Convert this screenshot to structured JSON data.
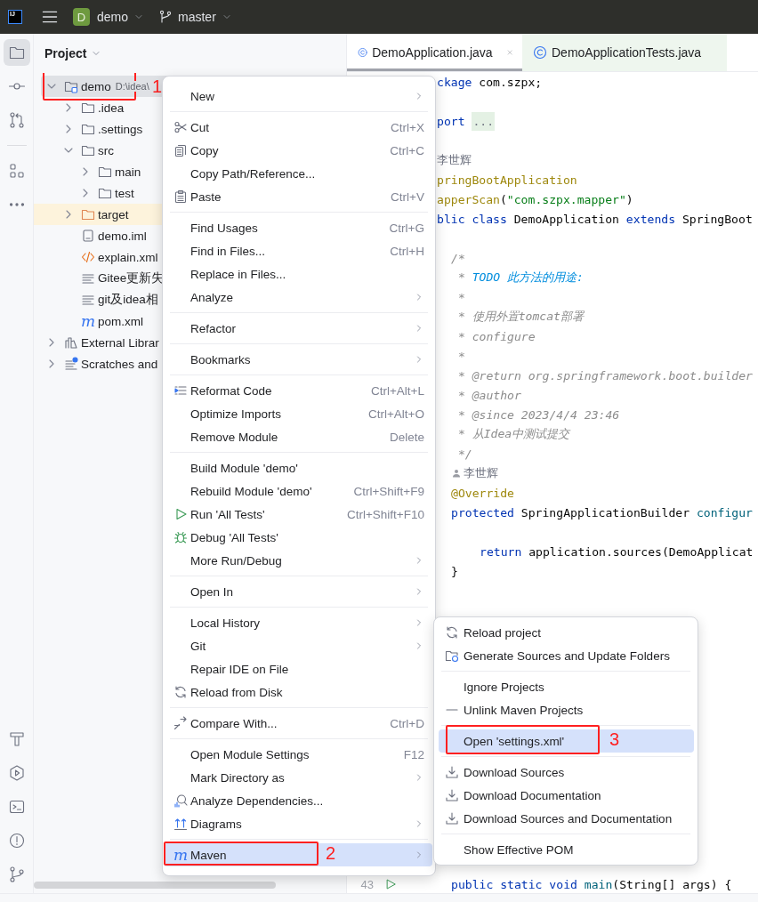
{
  "top_bar": {
    "logo": "IJ",
    "project_badge": "D",
    "project": "demo",
    "branch": "master"
  },
  "tool_strip": {
    "top_groups": [
      [
        {
          "kind": "project",
          "selected": true
        },
        {
          "kind": "commit",
          "selected": false
        },
        {
          "kind": "pull-requests",
          "selected": false
        }
      ],
      [
        {
          "kind": "structure",
          "selected": false
        },
        {
          "kind": "more",
          "selected": false
        }
      ]
    ],
    "bottom": [
      {
        "kind": "build",
        "selected": false
      },
      {
        "kind": "services",
        "selected": false
      },
      {
        "kind": "terminal",
        "selected": false
      },
      {
        "kind": "problems",
        "selected": false
      },
      {
        "kind": "git",
        "selected": false
      }
    ]
  },
  "project": {
    "title": "Project",
    "tree": [
      {
        "label": "demo",
        "path": "D:\\idea\\",
        "kind": "module",
        "expanded": true,
        "selected": true,
        "callout": "1",
        "children": [
          {
            "label": ".idea",
            "kind": "folder",
            "expanded": false,
            "selected": false
          },
          {
            "label": ".settings",
            "kind": "folder",
            "expanded": false,
            "selected": false
          },
          {
            "label": "src",
            "kind": "folder",
            "expanded": true,
            "selected": false,
            "children": [
              {
                "label": "main",
                "kind": "folder",
                "expanded": false,
                "selected": false
              },
              {
                "label": "test",
                "kind": "folder",
                "expanded": false,
                "selected": false
              }
            ]
          },
          {
            "label": "target",
            "kind": "excluded-folder",
            "expanded": false,
            "selected": false
          },
          {
            "label": "demo.iml",
            "kind": "iml",
            "selected": false
          },
          {
            "label": "explain.xml",
            "kind": "xml",
            "selected": false
          },
          {
            "label": "Gitee更新失",
            "kind": "text",
            "selected": false
          },
          {
            "label": "git及idea相",
            "kind": "text",
            "selected": false
          },
          {
            "label": "pom.xml",
            "kind": "maven",
            "glyph": "m",
            "selected": false
          }
        ]
      },
      {
        "label": "External Librar",
        "kind": "libraries",
        "expanded": false,
        "selected": false
      },
      {
        "label": "Scratches and",
        "kind": "scratches",
        "expanded": false,
        "selected": false
      }
    ]
  },
  "editor": {
    "tabs": [
      {
        "label": "DemoApplication.java",
        "kind": "source",
        "selected": true,
        "closable": true
      },
      {
        "label": "DemoApplicationTests.java",
        "kind": "test",
        "selected": false,
        "closable": false
      }
    ],
    "lines": [
      {
        "kind": "top",
        "parts": [
          {
            "kind": "keyword",
            "text": "ckage"
          },
          {
            "kind": "plain",
            "text": " com.szpx;"
          }
        ]
      },
      {
        "kind": "blank"
      },
      {
        "kind": "top",
        "parts": [
          {
            "kind": "keyword",
            "text": "port "
          },
          {
            "kind": "folded",
            "text": "..."
          }
        ]
      },
      {
        "kind": "blank"
      },
      {
        "kind": "top",
        "parts": [
          {
            "kind": "author",
            "text": "李世辉"
          }
        ]
      },
      {
        "kind": "top",
        "parts": [
          {
            "kind": "annotation",
            "text": "pringBootApplication"
          }
        ]
      },
      {
        "kind": "top",
        "parts": [
          {
            "kind": "annotation",
            "text": "apperScan"
          },
          {
            "kind": "plain",
            "text": "("
          },
          {
            "kind": "string",
            "text": "\"com.szpx.mapper\""
          },
          {
            "kind": "plain",
            "text": ")"
          }
        ]
      },
      {
        "kind": "top",
        "parts": [
          {
            "kind": "keyword",
            "text": "blic class"
          },
          {
            "kind": "plain",
            "text": " DemoApplication "
          },
          {
            "kind": "keyword",
            "text": "extends"
          },
          {
            "kind": "plain",
            "text": " SpringBoot"
          }
        ]
      },
      {
        "kind": "blank"
      },
      {
        "kind": "member",
        "parts": [
          {
            "kind": "comment",
            "text": "/*"
          }
        ]
      },
      {
        "kind": "member",
        "parts": [
          {
            "kind": "comment",
            "text": " * "
          },
          {
            "kind": "todo",
            "text": "TODO 此方法的用途:"
          }
        ]
      },
      {
        "kind": "member",
        "parts": [
          {
            "kind": "comment",
            "text": " *"
          }
        ]
      },
      {
        "kind": "member",
        "parts": [
          {
            "kind": "comment",
            "text": " * 使用外置tomcat部署"
          }
        ]
      },
      {
        "kind": "member",
        "parts": [
          {
            "kind": "comment",
            "text": " * configure"
          }
        ]
      },
      {
        "kind": "member",
        "parts": [
          {
            "kind": "comment",
            "text": " *"
          }
        ]
      },
      {
        "kind": "member",
        "parts": [
          {
            "kind": "comment",
            "text": " * "
          },
          {
            "kind": "doc-tag",
            "text": "@return"
          },
          {
            "kind": "comment",
            "text": " org.springframework.boot.builder"
          }
        ]
      },
      {
        "kind": "member",
        "parts": [
          {
            "kind": "comment",
            "text": " * "
          },
          {
            "kind": "doc-tag",
            "text": "@author"
          }
        ]
      },
      {
        "kind": "member",
        "parts": [
          {
            "kind": "comment",
            "text": " * "
          },
          {
            "kind": "doc-tag",
            "text": "@since"
          },
          {
            "kind": "comment",
            "text": " 2023/4/4 23:46"
          }
        ]
      },
      {
        "kind": "member",
        "parts": [
          {
            "kind": "comment",
            "text": " * 从Idea中测试提交"
          }
        ]
      },
      {
        "kind": "member",
        "parts": [
          {
            "kind": "comment",
            "text": " */"
          }
        ]
      },
      {
        "kind": "author",
        "parts": [
          {
            "kind": "author",
            "text": "李世辉"
          }
        ]
      },
      {
        "kind": "member",
        "parts": [
          {
            "kind": "annotation",
            "text": "@Override"
          }
        ]
      },
      {
        "kind": "member",
        "parts": [
          {
            "kind": "keyword",
            "text": "protected"
          },
          {
            "kind": "plain",
            "text": " SpringApplicationBuilder "
          },
          {
            "kind": "method",
            "text": "configur"
          }
        ]
      },
      {
        "kind": "blank"
      },
      {
        "kind": "body",
        "parts": [
          {
            "kind": "keyword",
            "text": "return"
          },
          {
            "kind": "plain",
            "text": " application.sources(DemoApplicat"
          }
        ]
      },
      {
        "kind": "member",
        "parts": [
          {
            "kind": "plain",
            "text": "}"
          }
        ]
      },
      {
        "kind": "blank"
      },
      {
        "kind": "blank"
      },
      {
        "kind": "blank"
      },
      {
        "kind": "blank"
      },
      {
        "kind": "blank"
      },
      {
        "kind": "blank"
      },
      {
        "kind": "blank"
      },
      {
        "kind": "blank"
      },
      {
        "kind": "blank"
      },
      {
        "kind": "blank"
      },
      {
        "kind": "blank"
      },
      {
        "kind": "blank"
      },
      {
        "kind": "blank"
      },
      {
        "kind": "blank"
      },
      {
        "kind": "blank"
      },
      {
        "kind": "member",
        "number": "43",
        "parts": [
          {
            "kind": "keyword",
            "text": "public static void "
          },
          {
            "kind": "method",
            "text": "main"
          },
          {
            "kind": "plain",
            "text": "(String[] args) {"
          }
        ]
      }
    ]
  },
  "context_menu": {
    "groups": [
      {
        "items": [
          {
            "label": "New",
            "kind": "plain",
            "submenu": true,
            "selected": false
          }
        ]
      },
      {
        "items": [
          {
            "label": "Cut",
            "kind": "cut",
            "shortcut": "Ctrl+X",
            "submenu": false,
            "selected": false
          },
          {
            "label": "Copy",
            "kind": "copy",
            "shortcut": "Ctrl+C",
            "submenu": false,
            "selected": false
          },
          {
            "label": "Copy Path/Reference...",
            "kind": "plain",
            "submenu": false,
            "selected": false
          },
          {
            "label": "Paste",
            "kind": "paste",
            "shortcut": "Ctrl+V",
            "submenu": false,
            "selected": false
          }
        ]
      },
      {
        "items": [
          {
            "label": "Find Usages",
            "kind": "plain",
            "shortcut": "Ctrl+G",
            "submenu": false,
            "selected": false
          },
          {
            "label": "Find in Files...",
            "kind": "plain",
            "shortcut": "Ctrl+H",
            "submenu": false,
            "selected": false
          },
          {
            "label": "Replace in Files...",
            "kind": "plain",
            "submenu": false,
            "selected": false
          },
          {
            "label": "Analyze",
            "kind": "plain",
            "submenu": true,
            "selected": false
          }
        ]
      },
      {
        "items": [
          {
            "label": "Refactor",
            "kind": "plain",
            "submenu": true,
            "selected": false
          }
        ]
      },
      {
        "items": [
          {
            "label": "Bookmarks",
            "kind": "plain",
            "submenu": true,
            "selected": false
          }
        ]
      },
      {
        "items": [
          {
            "label": "Reformat Code",
            "kind": "reformat",
            "shortcut": "Ctrl+Alt+L",
            "submenu": false,
            "selected": false
          },
          {
            "label": "Optimize Imports",
            "kind": "plain",
            "shortcut": "Ctrl+Alt+O",
            "submenu": false,
            "selected": false
          },
          {
            "label": "Remove Module",
            "kind": "plain",
            "shortcut": "Delete",
            "submenu": false,
            "selected": false
          }
        ]
      },
      {
        "items": [
          {
            "label": "Build Module 'demo'",
            "kind": "plain",
            "submenu": false,
            "selected": false
          },
          {
            "label": "Rebuild Module 'demo'",
            "kind": "plain",
            "shortcut": "Ctrl+Shift+F9",
            "submenu": false,
            "selected": false
          },
          {
            "label": "Run 'All Tests'",
            "kind": "run",
            "shortcut": "Ctrl+Shift+F10",
            "submenu": false,
            "selected": false
          },
          {
            "label": "Debug 'All Tests'",
            "kind": "debug",
            "submenu": false,
            "selected": false
          },
          {
            "label": "More Run/Debug",
            "kind": "plain",
            "submenu": true,
            "selected": false
          }
        ]
      },
      {
        "items": [
          {
            "label": "Open In",
            "kind": "plain",
            "submenu": true,
            "selected": false
          }
        ]
      },
      {
        "items": [
          {
            "label": "Local History",
            "kind": "plain",
            "submenu": true,
            "selected": false
          },
          {
            "label": "Git",
            "kind": "plain",
            "submenu": true,
            "selected": false
          },
          {
            "label": "Repair IDE on File",
            "kind": "plain",
            "submenu": false,
            "selected": false
          },
          {
            "label": "Reload from Disk",
            "kind": "reload",
            "submenu": false,
            "selected": false
          }
        ]
      },
      {
        "items": [
          {
            "label": "Compare With...",
            "kind": "compare",
            "shortcut": "Ctrl+D",
            "submenu": false,
            "selected": false
          }
        ]
      },
      {
        "items": [
          {
            "label": "Open Module Settings",
            "kind": "plain",
            "shortcut": "F12",
            "submenu": false,
            "selected": false
          },
          {
            "label": "Mark Directory as",
            "kind": "plain",
            "submenu": true,
            "selected": false
          },
          {
            "label": "Analyze Dependencies...",
            "kind": "dependencies",
            "submenu": false,
            "selected": false
          },
          {
            "label": "Diagrams",
            "kind": "diagrams",
            "submenu": true,
            "selected": false
          }
        ]
      },
      {
        "items": [
          {
            "label": "Maven",
            "kind": "maven",
            "glyph": "m",
            "submenu": true,
            "selected": true,
            "callout": "2"
          }
        ]
      }
    ]
  },
  "maven_submenu": {
    "groups": [
      {
        "items": [
          {
            "label": "Reload project",
            "kind": "reload",
            "submenu": false,
            "selected": false
          },
          {
            "label": "Generate Sources and Update Folders",
            "kind": "folder-sync",
            "submenu": false,
            "selected": false
          }
        ]
      },
      {
        "items": [
          {
            "label": "Ignore Projects",
            "kind": "plain",
            "submenu": false,
            "selected": false
          },
          {
            "label": "Unlink Maven Projects",
            "kind": "unlink",
            "submenu": false,
            "selected": false
          }
        ]
      },
      {
        "items": [
          {
            "label": "Open 'settings.xml'",
            "kind": "plain",
            "submenu": false,
            "selected": true,
            "callout": "3"
          }
        ]
      },
      {
        "items": [
          {
            "label": "Download Sources",
            "kind": "download",
            "submenu": false,
            "selected": false
          },
          {
            "label": "Download Documentation",
            "kind": "download",
            "submenu": false,
            "selected": false
          },
          {
            "label": "Download Sources and Documentation",
            "kind": "download",
            "submenu": false,
            "selected": false
          }
        ]
      },
      {
        "items": [
          {
            "label": "Show Effective POM",
            "kind": "plain",
            "submenu": false,
            "selected": false
          }
        ]
      }
    ]
  }
}
